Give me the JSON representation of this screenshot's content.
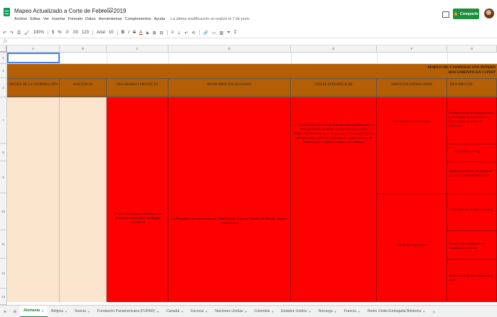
{
  "document": {
    "title": "Mapeo Actualizado a Corte de Febrero 2019",
    "menu": [
      "Archivo",
      "Editar",
      "Ver",
      "Insertar",
      "Formato",
      "Datos",
      "Herramientas",
      "Complementos",
      "Ayuda"
    ],
    "last_edit": "La última modificación se realizó el 7 de junio",
    "share_label": "Compartir"
  },
  "toolbar": {
    "zoom": "100%",
    "currency": "$",
    "percent": "%",
    "dec_decrease": ".0",
    "dec_increase": ".00",
    "number_format": "123",
    "font": "Arial",
    "font_size": "10",
    "bold": "B",
    "italic": "I",
    "strike": "S",
    "text_color": "A",
    "sum": "Σ"
  },
  "formula_bar": {
    "fx": "fx"
  },
  "columns": [
    "A",
    "B",
    "C",
    "D",
    "E",
    "F",
    "G"
  ],
  "rows": [
    "1",
    "2",
    "3",
    "7",
    "8",
    "9",
    "10",
    "11",
    "12",
    "13"
  ],
  "banner": {
    "title_line1": "MAPEO DE COOPERACIÓN INTERN",
    "title_line2": "DOCUMENTO EN CONST"
  },
  "headers": [
    "ORIGEN DE LA COOPERACIÓN",
    "ASISTENCIA",
    "PROGRAMA O PROYECTO",
    "MUNICIPIOS FOCALIZADOS",
    "LÍNEAS ESTRATÉGICAS",
    "SERVICIOS ENTREGADOS",
    "DESCRIPCIÓN"
  ],
  "cells": {
    "program": "Proyecto de Fomento del Desarrollo Económico Sostenible a la Región PRODEFE",
    "municipalities": "La Montañita, San José de Ancasá, Valle Dorado, Solecito, Cabañas, El Dorado, Gabriel, Puerto Cerre",
    "lines": "1. La asociación para la mejora de procesos mediante talleres sobre productos de turismo del proceso alianza de la Mancomunidad. Fortalecer los procesos de las mesas fiscales presupuestales, socio, los esquemas de cooperación que se impulsa para la mejora, cooperar a la industria.",
    "services1": "Fortalecimiento de la fiscalía",
    "services2": "Mesas de cooperación",
    "desc1": "Fortalecimiento de organizaciones y del registro en el marco de la mejora de los procesos de desarrollo",
    "desc2": "Actividades con ag",
    "desc3": "Implementación de los proyectos de la comunidad de desarrollo",
    "desc4": "Se fortalecerán los procesos de la",
    "desc5": "Apoyo a la actividad de los beneficiarios de la fa",
    "desc6": "Se ha desarrollado la región de la Apo"
  },
  "sheets": [
    "Alemania",
    "Bélgica",
    "Suecia",
    "Fundación Panamericana (FUPAD)",
    "Canadá",
    "Escocia",
    "Naciones Unidas",
    "Colombia",
    "Estados Unidos",
    "Noruega",
    "Francia",
    "Reino Unido-Embajada Británica"
  ]
}
